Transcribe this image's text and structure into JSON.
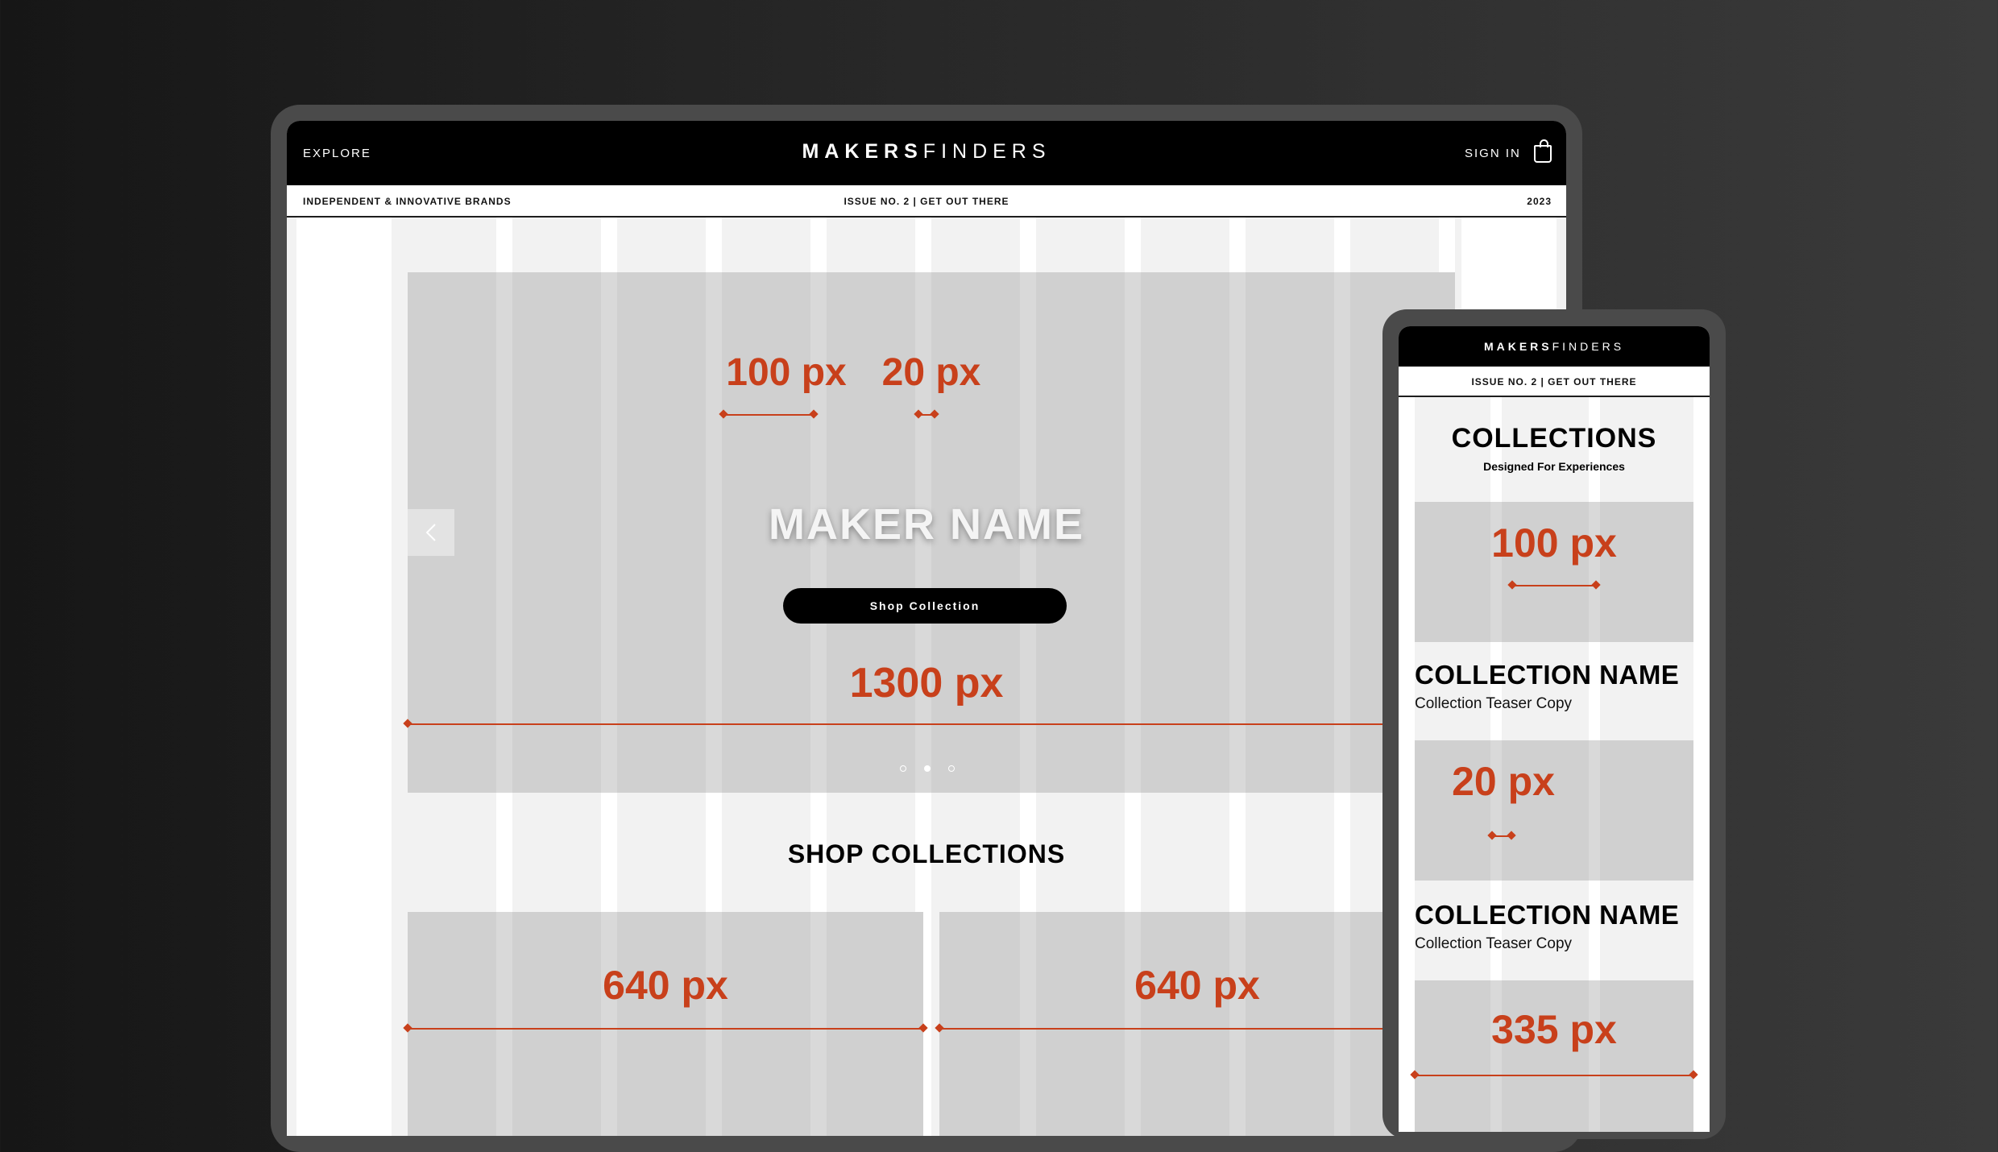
{
  "desktop": {
    "header": {
      "explore": "EXPLORE",
      "logo_bold": "MAKERS",
      "logo_light": "FINDERS",
      "sign_in": "SIGN IN",
      "cart_icon": "shopping-bag-icon"
    },
    "subbar": {
      "left": "INDEPENDENT & INNOVATIVE BRANDS",
      "center": "ISSUE NO. 2 | GET OUT THERE",
      "right": "2023"
    },
    "hero": {
      "column_label": "100 px",
      "gutter_label": "20 px",
      "maker_name": "MAKER NAME",
      "button": "Shop Collection",
      "width_label": "1300 px",
      "prev_icon": "chevron-left-icon",
      "carousel": {
        "slides": 3,
        "active": 2
      }
    },
    "shop": {
      "title": "SHOP COLLECTIONS",
      "tiles": [
        {
          "label": "640 px"
        },
        {
          "label": "640 px"
        }
      ]
    }
  },
  "mobile": {
    "header": {
      "logo_bold": "MAKERS",
      "logo_light": "FINDERS"
    },
    "subbar": "ISSUE NO. 2 | GET OUT THERE",
    "title": "COLLECTIONS",
    "tagline": "Designed For Experiences",
    "tiles": [
      {
        "label": "100 px",
        "name": "COLLECTION NAME",
        "teaser": "Collection Teaser Copy"
      },
      {
        "label": "20 px",
        "name": "COLLECTION NAME",
        "teaser": "Collection Teaser Copy"
      },
      {
        "label": "335 px"
      }
    ]
  },
  "colors": {
    "measure_accent": "#c8401b",
    "placeholder_gray": "#d0d0d0",
    "background": "#f2f2f2",
    "header": "#000000"
  }
}
